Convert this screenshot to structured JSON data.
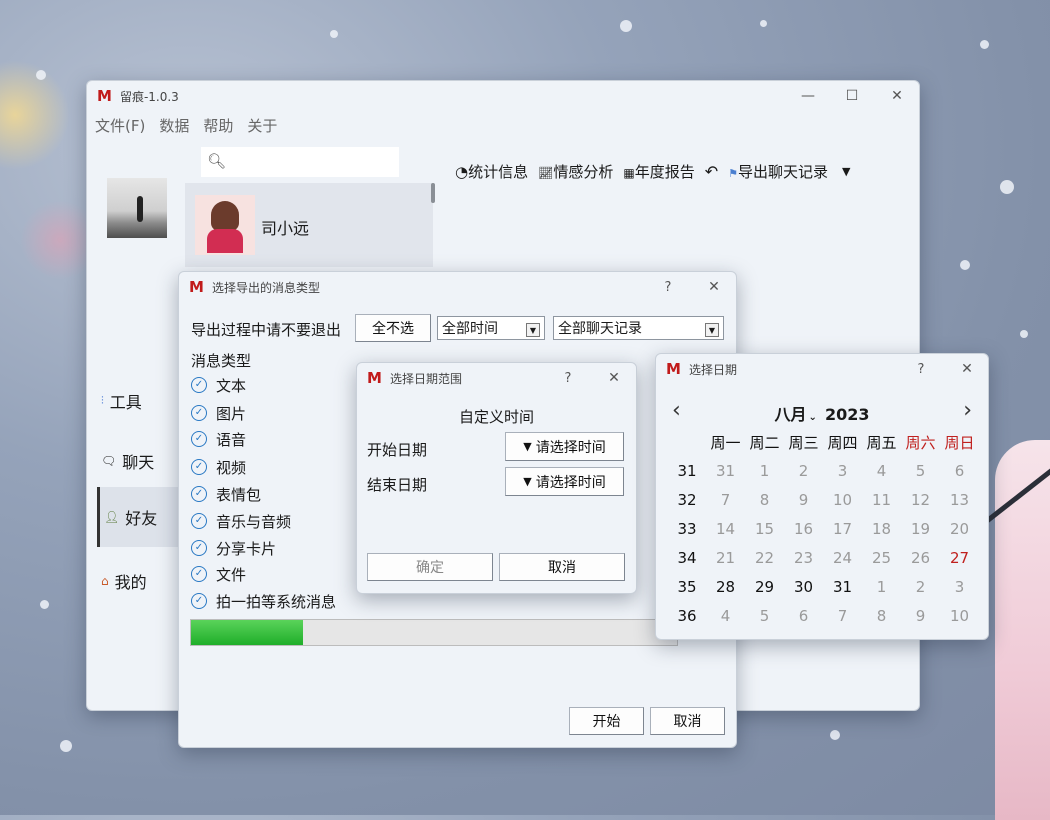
{
  "colors": {
    "accent": "#c11b1b",
    "check": "#2a79c4",
    "weekend": "#c0201e",
    "progress": "#2fb33a"
  },
  "main_window": {
    "title": "留痕-1.0.3",
    "menu": [
      "文件(F)",
      "数据",
      "帮助",
      "关于"
    ],
    "search_placeholder": "",
    "contact_name": "司小远",
    "toolbar": {
      "stats": "统计信息",
      "emotion": "情感分析",
      "annual": "年度报告",
      "export": "导出聊天记录"
    },
    "nav": {
      "tools": "工具",
      "chat": "聊天",
      "friends": "好友",
      "mine": "我的"
    }
  },
  "export_dialog": {
    "title": "选择导出的消息类型",
    "warning": "导出过程中请不要退出",
    "deselect_all": "全不选",
    "time_combo": "全部时间",
    "record_combo": "全部聊天记录",
    "types_label": "消息类型",
    "types": [
      "文本",
      "图片",
      "语音",
      "视频",
      "表情包",
      "音乐与音频",
      "分享卡片",
      "文件",
      "拍一拍等系统消息"
    ],
    "progress": 0.23,
    "start": "开始",
    "cancel": "取消",
    "help": "?"
  },
  "date_range_dialog": {
    "title": "选择日期范围",
    "heading": "自定义时间",
    "start_label": "开始日期",
    "end_label": "结束日期",
    "start_btn": "请选择时间",
    "end_btn": "请选择时间",
    "ok": "确定",
    "cancel": "取消",
    "help": "?"
  },
  "date_picker": {
    "title": "选择日期",
    "month": "八月",
    "year": "2023",
    "help": "?",
    "weekdays": [
      "周一",
      "周二",
      "周三",
      "周四",
      "周五",
      "周六",
      "周日"
    ],
    "weeks": [
      {
        "wk": "31",
        "days": [
          "31",
          "1",
          "2",
          "3",
          "4",
          "5",
          "6"
        ]
      },
      {
        "wk": "32",
        "days": [
          "7",
          "8",
          "9",
          "10",
          "11",
          "12",
          "13"
        ]
      },
      {
        "wk": "33",
        "days": [
          "14",
          "15",
          "16",
          "17",
          "18",
          "19",
          "20"
        ]
      },
      {
        "wk": "34",
        "days": [
          "21",
          "22",
          "23",
          "24",
          "25",
          "26",
          "27"
        ]
      },
      {
        "wk": "35",
        "days": [
          "28",
          "29",
          "30",
          "31",
          "1",
          "2",
          "3"
        ]
      },
      {
        "wk": "36",
        "days": [
          "4",
          "5",
          "6",
          "7",
          "8",
          "9",
          "10"
        ]
      }
    ]
  }
}
